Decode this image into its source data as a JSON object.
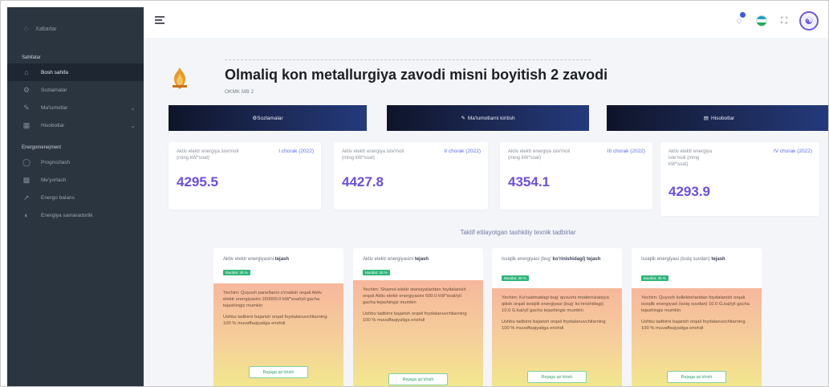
{
  "sidebar": {
    "top_item": "Xabarlar",
    "section1": "Sahifalar",
    "items1": [
      {
        "label": "Bosh sahifa",
        "icon": "home-icon"
      },
      {
        "label": "Sozlamalar",
        "icon": "gear-icon"
      },
      {
        "label": "Ma'lumotlar",
        "icon": "edit-icon"
      },
      {
        "label": "Hisobotlar",
        "icon": "table-icon"
      }
    ],
    "section2": "Energomenejment",
    "items2": [
      {
        "label": "Prognozlash",
        "icon": "forecast-icon"
      },
      {
        "label": "Me'yorlash",
        "icon": "grid-icon"
      },
      {
        "label": "Energo balans",
        "icon": "chart-icon"
      },
      {
        "label": "Energiya samaradorlik",
        "icon": "gauge-icon"
      }
    ]
  },
  "header": {
    "title": "Olmaliq kon metallurgiya zavodi misni boyitish 2 zavodi",
    "subtitle": "OKMK MB 2"
  },
  "nav_buttons": [
    "⚙Sozlamalar",
    "Ma'lumotlarni kiritish",
    "Hisobotlar"
  ],
  "stats": [
    {
      "label": "Aktiv elektr energiya iste'moli (ming kW*soat)",
      "quarter": "I chorak (2022)",
      "value": "4295.5"
    },
    {
      "label": "Aktiv elektr energiya iste'moli (ming kW*soat)",
      "quarter": "II chorak (2022)",
      "value": "4427.8"
    },
    {
      "label": "Aktiv elektr energiya iste'moli (ming kW*soat)",
      "quarter": "III chorak (2022)",
      "value": "4354.1"
    },
    {
      "label": "Aktiv elektr energiya iste'moli (ming kW*soat)",
      "quarter": "IV chorak (2022)",
      "value": "4293.9"
    }
  ],
  "section_title": "Taklif etilayotgan tashkiliy texnik tadbirlar",
  "cards": [
    {
      "title_a": "Aktiv elektr energiyasini ",
      "title_b": "tejash",
      "badge": "Muddat: 30 %",
      "p1": "Yechim: Quyosh panellarini o'rnatish orqali Aktiv elektr energiyasini 150000.0 kW*soat/yil gacha tejashingiz mumkin",
      "p2": "Ushbu tadbirni bajarish orqali foydalanuvchilarning 100 % muvaffaqiyatiga erishdi",
      "button": "Rejaga qo'shish"
    },
    {
      "title_a": "Aktiv elektr energiyasini ",
      "title_b": "tejash",
      "badge": "Muddat: 30 %",
      "p1": "Yechim: Shamol elektr stansiyalaridan foydalanish orqali Aktiv elektr energiyasini 500.0 kW*soat/yil gacha tejashingiz mumkin",
      "p2": "Ushbu tadbirni bajarish orqali foydalanuvchilarning 100 % muvaffaqiyatiga erishdi",
      "button": "Rejaga qo'shish"
    },
    {
      "title_a": "Issiqlik energiyasi (bug' ",
      "title_b": "ko'rinishidagi) tejash",
      "badge": "Muddat: 30 %",
      "p1": "Yechim: Ko'rsatmadagi bug' quvurini modernizatsiya qilish orqali issiqlik energiyasi (bug' ko'rinishidagi) 10.0 G.kal/yil gacha tejashingiz mumkin",
      "p2": "Ushbu tadbirni bajarish orqali foydalanuvchilarning 100 % muvaffaqiyatiga erishdi",
      "button": "Rejaga qo'shish"
    },
    {
      "title_a": "Issiqlik energiyasi (issiq suvdan) ",
      "title_b": "tejash",
      "badge": "Muddat: 30 %",
      "p1": "Yechim: Quyosh kollektorlaridan foydalanish orqali issiqlik energiyasi (issiq suvdan) 10.0 G.kal/yil gacha tejashingiz mumkin",
      "p2": "Ushbu tadbirni bajarish orqali foydalanuvchilarning 100 % muvaffaqiyatiga erishdi",
      "button": "Rejaga qo'shish"
    }
  ]
}
